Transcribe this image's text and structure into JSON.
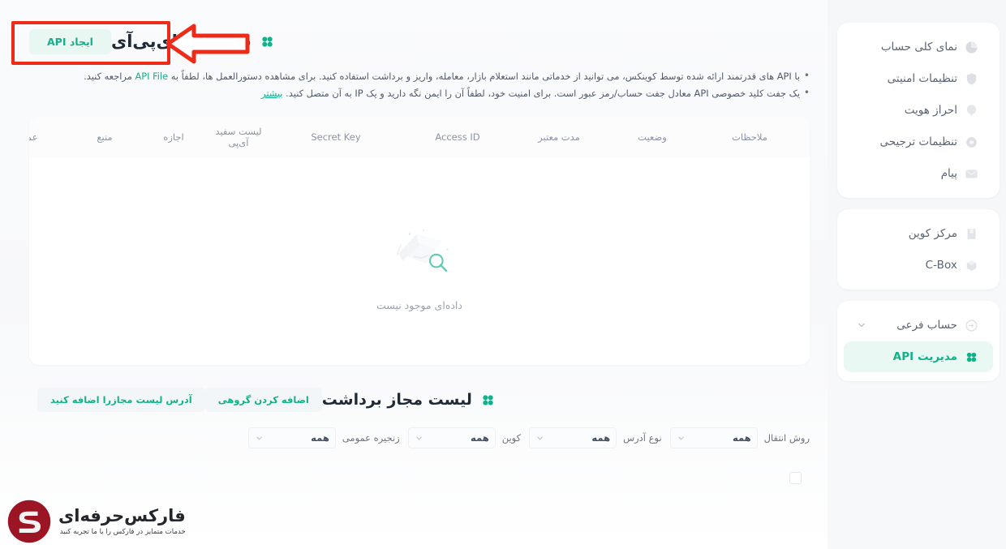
{
  "sidebar": {
    "groups": [
      {
        "name": "account-group",
        "items": [
          {
            "label": "نمای کلی حساب",
            "icon": "pie-chart-icon",
            "active": false
          },
          {
            "label": "تنظیمات امنیتی",
            "icon": "shield-icon",
            "active": false
          },
          {
            "label": "احراز هویت",
            "icon": "badge-check-icon",
            "active": false
          },
          {
            "label": "تنظیمات ترجیحی",
            "icon": "sliders-icon",
            "active": false
          },
          {
            "label": "پیام",
            "icon": "envelope-icon",
            "active": false
          }
        ]
      },
      {
        "name": "assets-group",
        "items": [
          {
            "label": "مرکز کوین",
            "icon": "coin-stack-icon",
            "active": false
          },
          {
            "label": "C-Box",
            "icon": "box-icon",
            "active": false
          }
        ]
      },
      {
        "name": "api-group",
        "items": [
          {
            "label": "حساب فرعی",
            "icon": "users-icon",
            "active": false,
            "chevron": "chevron-down-icon"
          },
          {
            "label": "مدیریت API",
            "icon": "four-dots-icon",
            "active": true
          }
        ]
      }
    ]
  },
  "header": {
    "title": "فهرست ای‌پی‌آی",
    "title_icon": "four-dots-icon",
    "create_button": "ایجاد API"
  },
  "notices": [
    {
      "text_before": "با API های قدرتمند ارائه شده توسط کوینکس، می توانید از خدماتی مانند استعلام بازار، معامله، واریز و برداشت استفاده کنید. برای مشاهده دستورالعمل ها، لطفاً به ",
      "link": "API File",
      "text_after": " مراجعه کنید."
    },
    {
      "text_before": "یک جفت کلید خصوصی API معادل جفت حساب/رمز عبور است. برای امنیت خود، لطفاً آن را ایمن نگه دارید و یک IP به آن متصل کنید. ",
      "link": "بیشتر",
      "text_after": ""
    }
  ],
  "table": {
    "columns": [
      {
        "key": "notes",
        "label": "ملاحظات"
      },
      {
        "key": "status",
        "label": "وضعیت"
      },
      {
        "key": "valid",
        "label": "مدت معتبر"
      },
      {
        "key": "access",
        "label": "Access ID"
      },
      {
        "key": "secret",
        "label": "Secret Key"
      },
      {
        "key": "ip",
        "label": "لیست سفید آی‌پی"
      },
      {
        "key": "perm",
        "label": "اجازه"
      },
      {
        "key": "src",
        "label": "منبع"
      },
      {
        "key": "ops",
        "label": "عملیات"
      }
    ],
    "rows": [],
    "empty_text": "داده‌ای موجود نیست",
    "empty_icon": "empty-box-icon"
  },
  "withdraw_section": {
    "title": "لیست مجاز برداشت",
    "title_icon": "four-dots-icon",
    "buttons": [
      {
        "label": "اضافه کردن گروهی",
        "name": "batch-add-button"
      },
      {
        "label": "آدرس لیست مجازرا اضافه کنید",
        "name": "add-whitelist-address-button"
      }
    ],
    "filters": [
      {
        "label": "روش انتقال",
        "value": "همه",
        "name": "transfer-method-filter"
      },
      {
        "label": "نوع آدرس",
        "value": "همه",
        "name": "address-type-filter"
      },
      {
        "label": "کوین",
        "value": "همه",
        "name": "coin-filter"
      },
      {
        "label": "زنجیره عمومی",
        "value": "همه",
        "name": "chain-filter"
      }
    ],
    "caret_icon": "chevron-down-icon",
    "select_all_checkbox": false
  },
  "annotation": {
    "box_color": "#ee2b18",
    "arrow_icon": "left-arrow-annotation"
  },
  "watermark": {
    "title": "فارکس‌حرفه‌ای",
    "subtitle": "خدمات متمایز در فارکس را با ما تجربه کنید",
    "mark_icon": "forex-s-logo",
    "mark_color": "#9c1524"
  },
  "colors": {
    "accent": "#13b089",
    "accent_bg": "#eaf8f4",
    "annotation": "#ee2b18",
    "text": "#1f2a37",
    "muted": "#8b94a3",
    "page_bg": "#f7f8fa"
  }
}
